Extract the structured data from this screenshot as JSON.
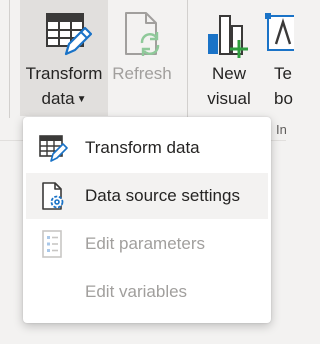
{
  "ribbon": {
    "transform": {
      "line1": "Transform",
      "line2": "data",
      "icon": "table-pencil-icon"
    },
    "refresh": {
      "label": "Refresh",
      "icon": "document-refresh-icon"
    },
    "new_visual": {
      "line1": "New",
      "line2": "visual",
      "icon": "bar-chart-add-icon"
    },
    "text_box": {
      "line1": "Te",
      "line2": "bo",
      "icon": "text-box-icon"
    },
    "group_label": "In"
  },
  "menu": {
    "items": [
      {
        "label": "Transform data",
        "icon": "table-pencil-icon",
        "state": "enabled"
      },
      {
        "label": "Data source settings",
        "icon": "document-gear-icon",
        "state": "hover"
      },
      {
        "label": "Edit parameters",
        "icon": "parameters-list-icon",
        "state": "disabled"
      },
      {
        "label": "Edit variables",
        "icon": "",
        "state": "disabled"
      }
    ]
  },
  "colors": {
    "accent": "#1a73c7",
    "green": "#2e9e3e",
    "disabled": "#a19f9d",
    "ribbon_bg": "#f3f2f1",
    "pressed_bg": "#e1dfdd"
  }
}
